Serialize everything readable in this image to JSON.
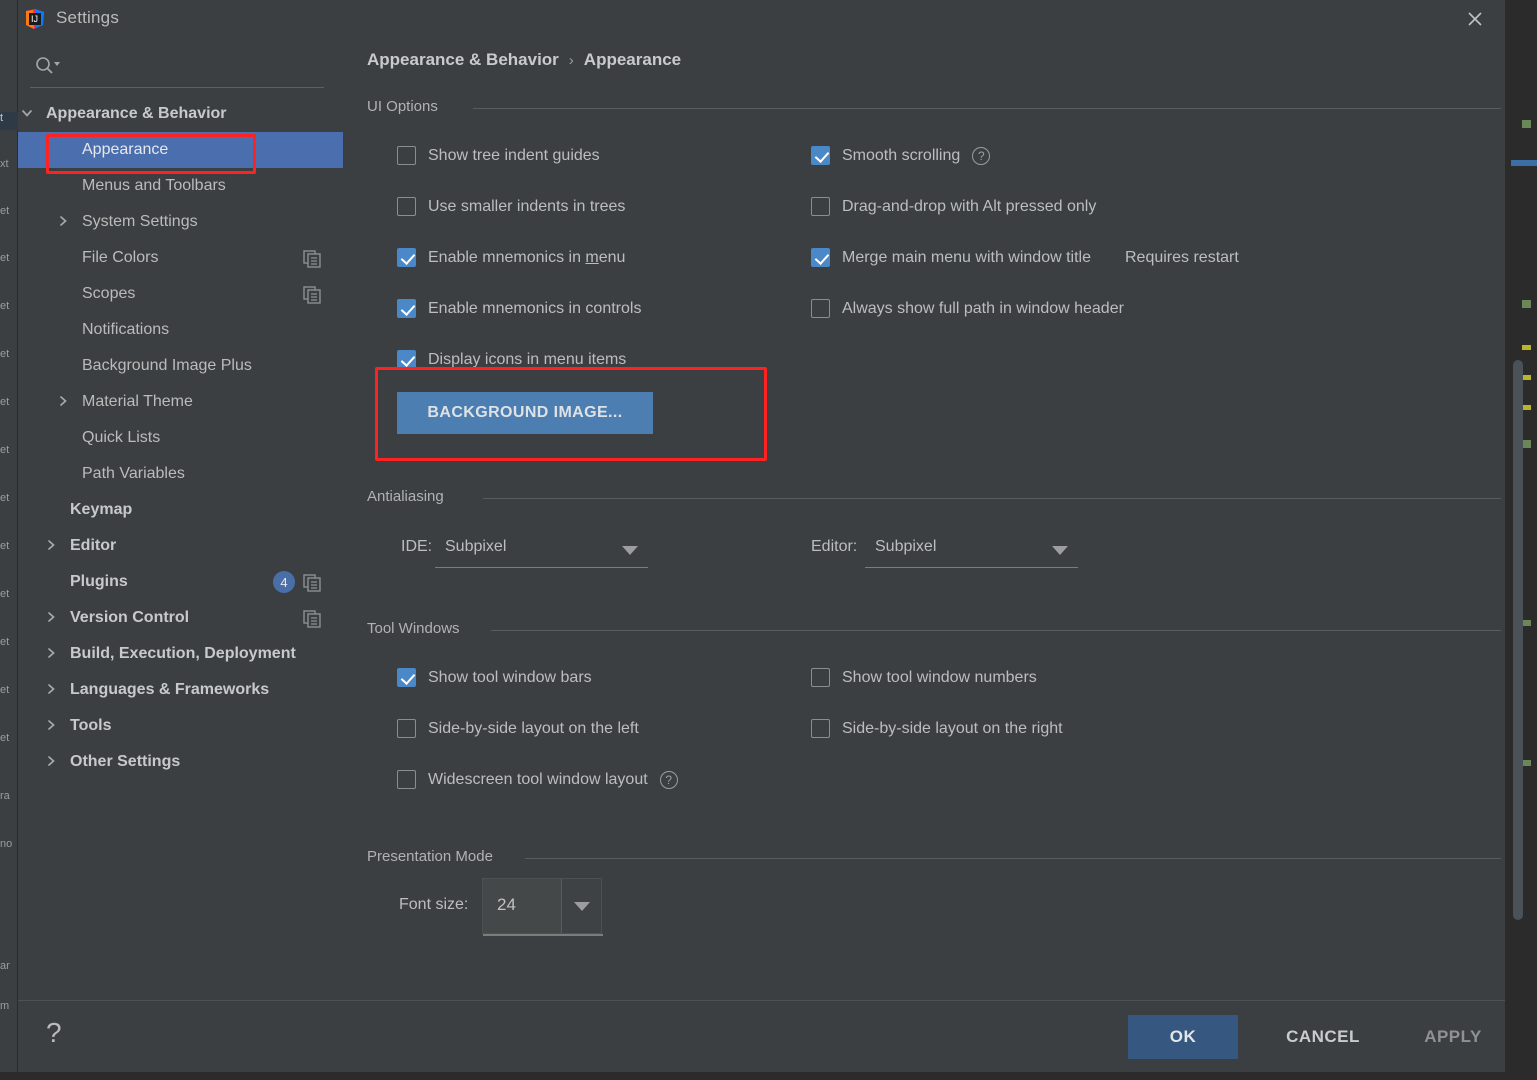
{
  "window": {
    "title": "Settings",
    "logo_icon": "intellij-idea-logo",
    "close_icon": "close-icon"
  },
  "search": {
    "icon": "search-icon",
    "value": "",
    "placeholder": ""
  },
  "sidebar": {
    "items": [
      {
        "label": "Appearance & Behavior",
        "indent": 28,
        "arrow": "chevron-down-icon",
        "bold": true,
        "selected": false,
        "badge": null,
        "copy": false
      },
      {
        "label": "Appearance",
        "indent": 64,
        "arrow": null,
        "bold": false,
        "selected": true,
        "badge": null,
        "copy": false
      },
      {
        "label": "Menus and Toolbars",
        "indent": 64,
        "arrow": null,
        "bold": false,
        "selected": false,
        "badge": null,
        "copy": false
      },
      {
        "label": "System Settings",
        "indent": 64,
        "arrow": "chevron-right-icon",
        "bold": false,
        "selected": false,
        "badge": null,
        "copy": false
      },
      {
        "label": "File Colors",
        "indent": 64,
        "arrow": null,
        "bold": false,
        "selected": false,
        "badge": null,
        "copy": true
      },
      {
        "label": "Scopes",
        "indent": 64,
        "arrow": null,
        "bold": false,
        "selected": false,
        "badge": null,
        "copy": true
      },
      {
        "label": "Notifications",
        "indent": 64,
        "arrow": null,
        "bold": false,
        "selected": false,
        "badge": null,
        "copy": false
      },
      {
        "label": "Background Image Plus",
        "indent": 64,
        "arrow": null,
        "bold": false,
        "selected": false,
        "badge": null,
        "copy": false
      },
      {
        "label": "Material Theme",
        "indent": 64,
        "arrow": "chevron-right-icon",
        "bold": false,
        "selected": false,
        "badge": null,
        "copy": false
      },
      {
        "label": "Quick Lists",
        "indent": 64,
        "arrow": null,
        "bold": false,
        "selected": false,
        "badge": null,
        "copy": false
      },
      {
        "label": "Path Variables",
        "indent": 64,
        "arrow": null,
        "bold": false,
        "selected": false,
        "badge": null,
        "copy": false
      },
      {
        "label": "Keymap",
        "indent": 52,
        "arrow": null,
        "bold": true,
        "selected": false,
        "badge": null,
        "copy": false
      },
      {
        "label": "Editor",
        "indent": 52,
        "arrow": "chevron-right-icon",
        "bold": true,
        "selected": false,
        "badge": null,
        "copy": false
      },
      {
        "label": "Plugins",
        "indent": 52,
        "arrow": null,
        "bold": true,
        "selected": false,
        "badge": "4",
        "copy": true
      },
      {
        "label": "Version Control",
        "indent": 52,
        "arrow": "chevron-right-icon",
        "bold": true,
        "selected": false,
        "badge": null,
        "copy": true
      },
      {
        "label": "Build, Execution, Deployment",
        "indent": 52,
        "arrow": "chevron-right-icon",
        "bold": true,
        "selected": false,
        "badge": null,
        "copy": false
      },
      {
        "label": "Languages & Frameworks",
        "indent": 52,
        "arrow": "chevron-right-icon",
        "bold": true,
        "selected": false,
        "badge": null,
        "copy": false
      },
      {
        "label": "Tools",
        "indent": 52,
        "arrow": "chevron-right-icon",
        "bold": true,
        "selected": false,
        "badge": null,
        "copy": false
      },
      {
        "label": "Other Settings",
        "indent": 52,
        "arrow": "chevron-right-icon",
        "bold": true,
        "selected": false,
        "badge": null,
        "copy": false
      }
    ]
  },
  "breadcrumb": {
    "root": "Appearance & Behavior",
    "separator": "›",
    "current": "Appearance"
  },
  "sections": {
    "ui_options": {
      "title": "UI Options",
      "left_checkboxes": [
        {
          "label": "Show tree indent guides",
          "checked": false,
          "mnemonic": ""
        },
        {
          "label": "Use smaller indents in trees",
          "checked": false,
          "mnemonic": ""
        },
        {
          "label": "Enable mnemonics in menu",
          "checked": true,
          "mnemonic": "m"
        },
        {
          "label": "Enable mnemonics in controls",
          "checked": true,
          "mnemonic": ""
        },
        {
          "label": "Display icons in menu items",
          "checked": true,
          "mnemonic": ""
        }
      ],
      "right_checkboxes": [
        {
          "label": "Smooth scrolling",
          "checked": true,
          "help": true,
          "note": ""
        },
        {
          "label": "Drag-and-drop with Alt pressed only",
          "checked": false,
          "help": false,
          "note": ""
        },
        {
          "label": "Merge main menu with window title",
          "checked": true,
          "help": false,
          "note": "Requires restart"
        },
        {
          "label": "Always show full path in window header",
          "checked": false,
          "help": false,
          "note": ""
        }
      ],
      "background_image_button": "BACKGROUND IMAGE..."
    },
    "antialiasing": {
      "title": "Antialiasing",
      "ide_label": "IDE:",
      "ide_value": "Subpixel",
      "editor_label": "Editor:",
      "editor_value": "Subpixel"
    },
    "tool_windows": {
      "title": "Tool Windows",
      "left_checkboxes": [
        {
          "label": "Show tool window bars",
          "checked": true,
          "help": false
        },
        {
          "label": "Side-by-side layout on the left",
          "checked": false,
          "help": false
        },
        {
          "label": "Widescreen tool window layout",
          "checked": false,
          "help": true
        }
      ],
      "right_checkboxes": [
        {
          "label": "Show tool window numbers",
          "checked": false,
          "help": false
        },
        {
          "label": "Side-by-side layout on the right",
          "checked": false,
          "help": false
        }
      ]
    },
    "presentation_mode": {
      "title": "Presentation Mode",
      "font_size_label": "Font size:",
      "font_size_value": "24"
    }
  },
  "footer": {
    "help_icon": "question-mark-icon",
    "ok": "OK",
    "cancel": "CANCEL",
    "apply": "APPLY"
  },
  "colors": {
    "dialog_bg": "#3c3f41",
    "selection_blue": "#4b6eaf",
    "checkbox_blue": "#4a88c7",
    "button_blue": "#4d7eb2",
    "ok_blue": "#365880",
    "highlight_red": "#ff2222",
    "text": "#bbbbbb"
  }
}
